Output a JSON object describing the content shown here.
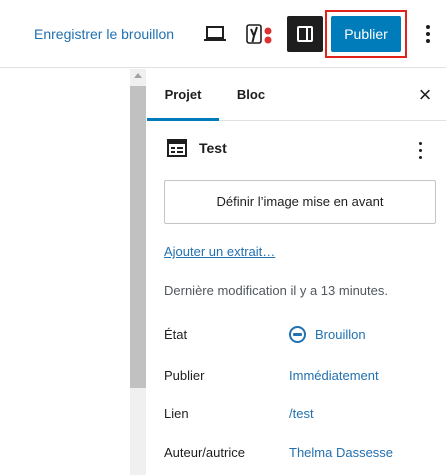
{
  "header": {
    "save_draft_label": "Enregistrer le brouillon",
    "publish_label": "Publier",
    "preview_icon": "laptop-icon",
    "yoast_icon": "yoast-seo-icon",
    "settings_icon": "sidebar-toggle-icon",
    "more_icon": "vertical-ellipsis-icon",
    "accent_color": "#007cba",
    "highlight_color": "#e2231a"
  },
  "sidebar": {
    "tabs": [
      {
        "label": "Projet",
        "active": true
      },
      {
        "label": "Bloc",
        "active": false
      }
    ],
    "close_icon": "close-icon",
    "post": {
      "title": "Test",
      "icon": "document-layout-icon"
    },
    "featured_image_label": "Définir l’image mise en avant",
    "excerpt_link": "Ajouter un extrait…",
    "last_modified": "Dernière modification il y a 13 minutes.",
    "rows": [
      {
        "label": "État",
        "value": "Brouillon",
        "icon": "draft-status-icon"
      },
      {
        "label": "Publier",
        "value": "Immédiatement"
      },
      {
        "label": "Lien",
        "value": "/test"
      },
      {
        "label": "Auteur/autrice",
        "value": "Thelma Dassesse"
      }
    ]
  }
}
